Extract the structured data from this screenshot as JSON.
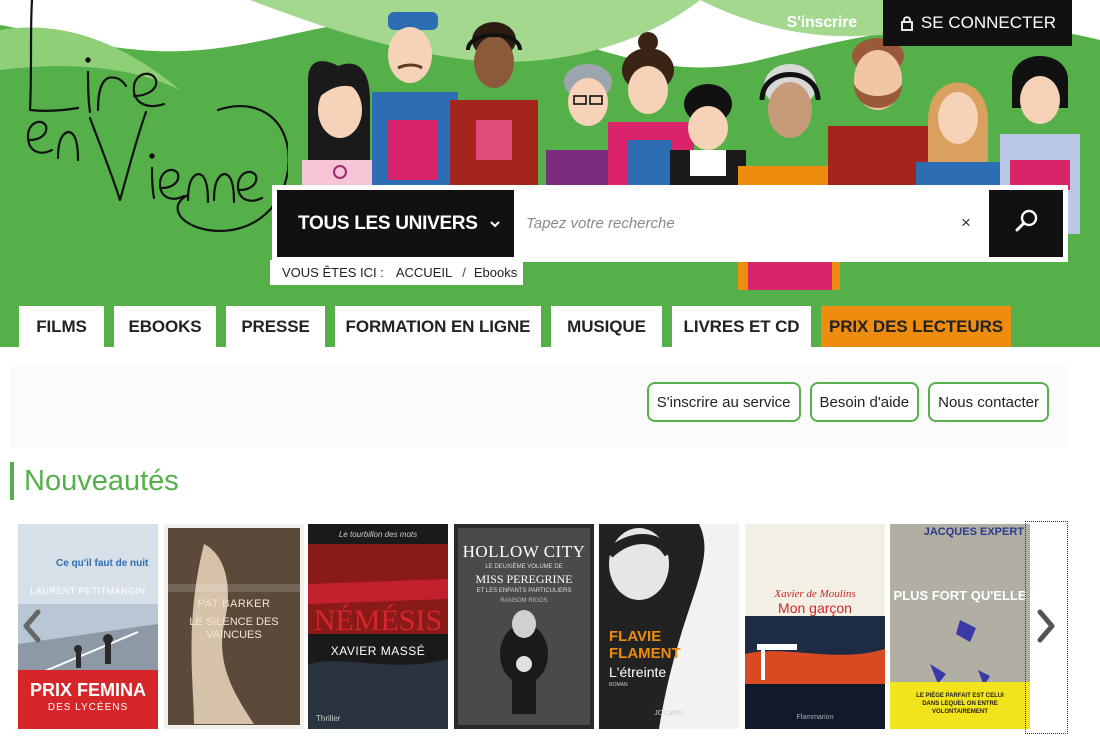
{
  "header": {
    "logo_text": "Lire en Vienne",
    "signup_link": "S'inscrire",
    "login_button": "SE CONNECTER",
    "brand_color": "#55b04a"
  },
  "search": {
    "universe_button": "TOUS LES UNIVERS",
    "placeholder": "Tapez votre recherche",
    "clear_symbol": "×"
  },
  "breadcrumb": {
    "label": "VOUS ÊTES ICI :",
    "home": "ACCUEIL",
    "separator": "/",
    "current": "Ebooks"
  },
  "tabs": [
    {
      "label": "FILMS"
    },
    {
      "label": "EBOOKS"
    },
    {
      "label": "PRESSE"
    },
    {
      "label": "FORMATION EN LIGNE"
    },
    {
      "label": "MUSIQUE"
    },
    {
      "label": "LIVRES ET CD"
    },
    {
      "label": "PRIX DES LECTEURS",
      "color": "#ee8c10"
    }
  ],
  "service_buttons": [
    {
      "label": "S'inscrire au service"
    },
    {
      "label": "Besoin d'aide"
    },
    {
      "label": "Nous contacter"
    }
  ],
  "section": {
    "title": "Nouveautés"
  },
  "books": [
    {
      "title": "Ce qu'il faut de nuit",
      "author": "LAURENT PETITMANGIN",
      "badge": "PRIX FEMINA",
      "badge_sub": "DES LYCÉENS"
    },
    {
      "title": "LE SILENCE DES VAINCUES",
      "author": "PAT BARKER"
    },
    {
      "title": "NÉMÉSIS",
      "author": "XAVIER MASSÉ",
      "series": "Le tourbillon des mots",
      "genre": "Thriller"
    },
    {
      "title": "HOLLOW CITY",
      "author": "RANSOM RIGGS",
      "subtitle": "MISS PEREGRINE",
      "tagline": "LE DEUXIÈME VOLUME DE",
      "subtitle2": "ET LES ENFANTS PARTICULIERS"
    },
    {
      "title": "L'étreinte",
      "author": "FLAVIE FLAMENT",
      "publisher": "JC Lattès",
      "genre": "ROMAN"
    },
    {
      "title": "Mon garçon",
      "author": "Xavier de Moulins",
      "publisher": "Flammarion"
    },
    {
      "title": "PLUS FORT QU'ELLE",
      "author": "JACQUES EXPERT",
      "blurb": "LE PIÈGE PARFAIT EST CELUI DANS LEQUEL ON ENTRE VOLONTAIREMENT"
    }
  ]
}
